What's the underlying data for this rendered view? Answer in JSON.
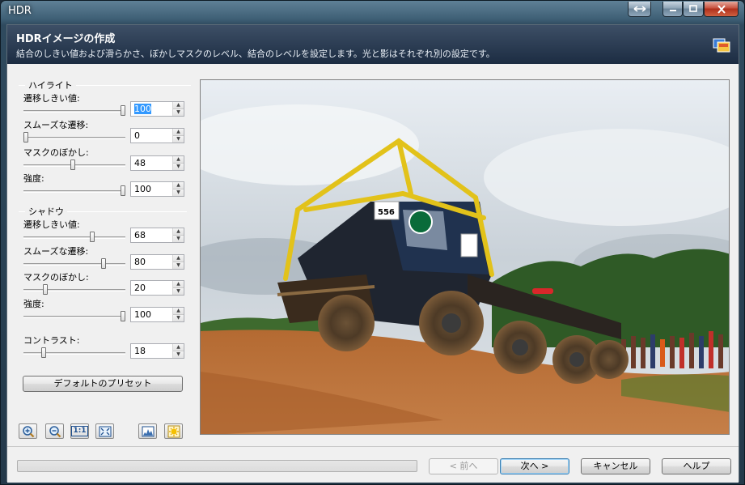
{
  "window": {
    "title": "HDR"
  },
  "header": {
    "title": "HDRイメージの作成",
    "subtitle": "結合のしきい値および滑らかさ、ぼかしマスクのレベル、結合のレベルを設定します。光と影はそれぞれ別の設定です。"
  },
  "highlight": {
    "title": "ハイライト",
    "controls": [
      {
        "label": "遷移しきい値:",
        "value": "100",
        "level": 1.0
      },
      {
        "label": "スムーズな遷移:",
        "value": "0",
        "level": 0.0
      },
      {
        "label": "マスクのぼかし:",
        "value": "48",
        "level": 0.48
      },
      {
        "label": "強度:",
        "value": "100",
        "level": 1.0
      }
    ]
  },
  "shadow": {
    "title": "シャドウ",
    "controls": [
      {
        "label": "遷移しきい値:",
        "value": "68",
        "level": 0.68
      },
      {
        "label": "スムーズな遷移:",
        "value": "80",
        "level": 0.8
      },
      {
        "label": "マスクのぼかし:",
        "value": "20",
        "level": 0.2
      },
      {
        "label": "強度:",
        "value": "100",
        "level": 1.0
      }
    ]
  },
  "contrast": {
    "label": "コントラスト:",
    "value": "18",
    "level": 0.18
  },
  "default_preset_label": "デフォルトのプリセット",
  "toolbar": {
    "zoom_in": "zoom-in-icon",
    "zoom_out": "zoom-out-icon",
    "actual_size": "1:1",
    "fit": "fit-window-icon",
    "histogram": "histogram-icon",
    "brightness": "brightness-icon"
  },
  "footer": {
    "back_label": "< 前へ",
    "next_label": "次へ >",
    "cancel_label": "キャンセル",
    "help_label": "ヘルプ"
  },
  "preview": {
    "truck_number": "556"
  }
}
